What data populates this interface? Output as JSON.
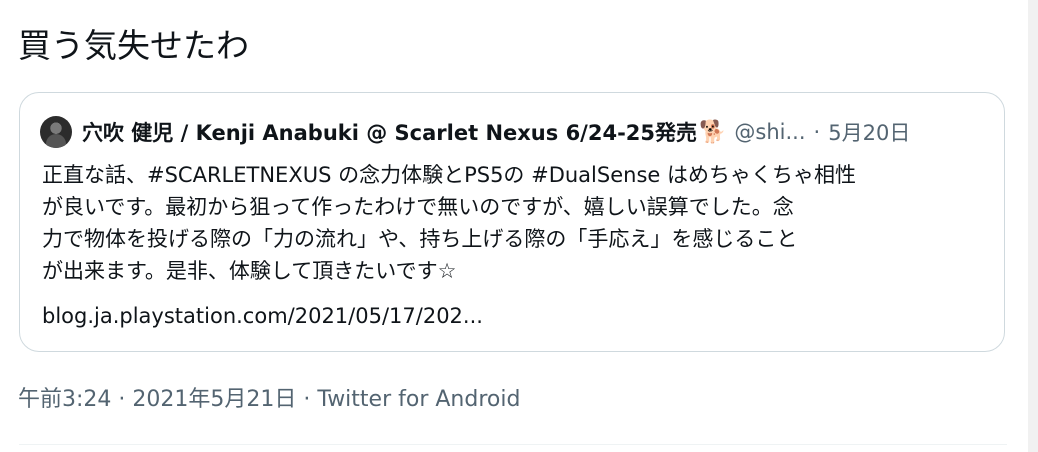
{
  "tweet": {
    "text": "買う気失せたわ"
  },
  "quote": {
    "display_name": "穴吹 健児 / Kenji Anabuki @ Scarlet Nexus 6/24-25発売",
    "name_emoji": "🐕",
    "handle": "@shi...",
    "separator": "·",
    "date": "5月20日",
    "lines": [
      "正直な話、#SCARLETNEXUS の念力体験とPS5の #DualSense はめちゃくちゃ相性",
      "が良いです。最初から狙って作ったわけで無いのですが、嬉しい誤算でした。念",
      "力で物体を投げる際の「力の流れ」や、持ち上げる際の「手応え」を感じること",
      "が出来ます。是非、体験して頂きたいです☆"
    ],
    "link": "blog.ja.playstation.com/2021/05/17/202..."
  },
  "meta": {
    "time": "午前3:24",
    "separator1": "·",
    "date": "2021年5月21日",
    "separator2": "·",
    "source": "Twitter for Android"
  },
  "colors": {
    "text_primary": "#0f1419",
    "text_secondary": "#536471",
    "border": "#cfd9de"
  }
}
